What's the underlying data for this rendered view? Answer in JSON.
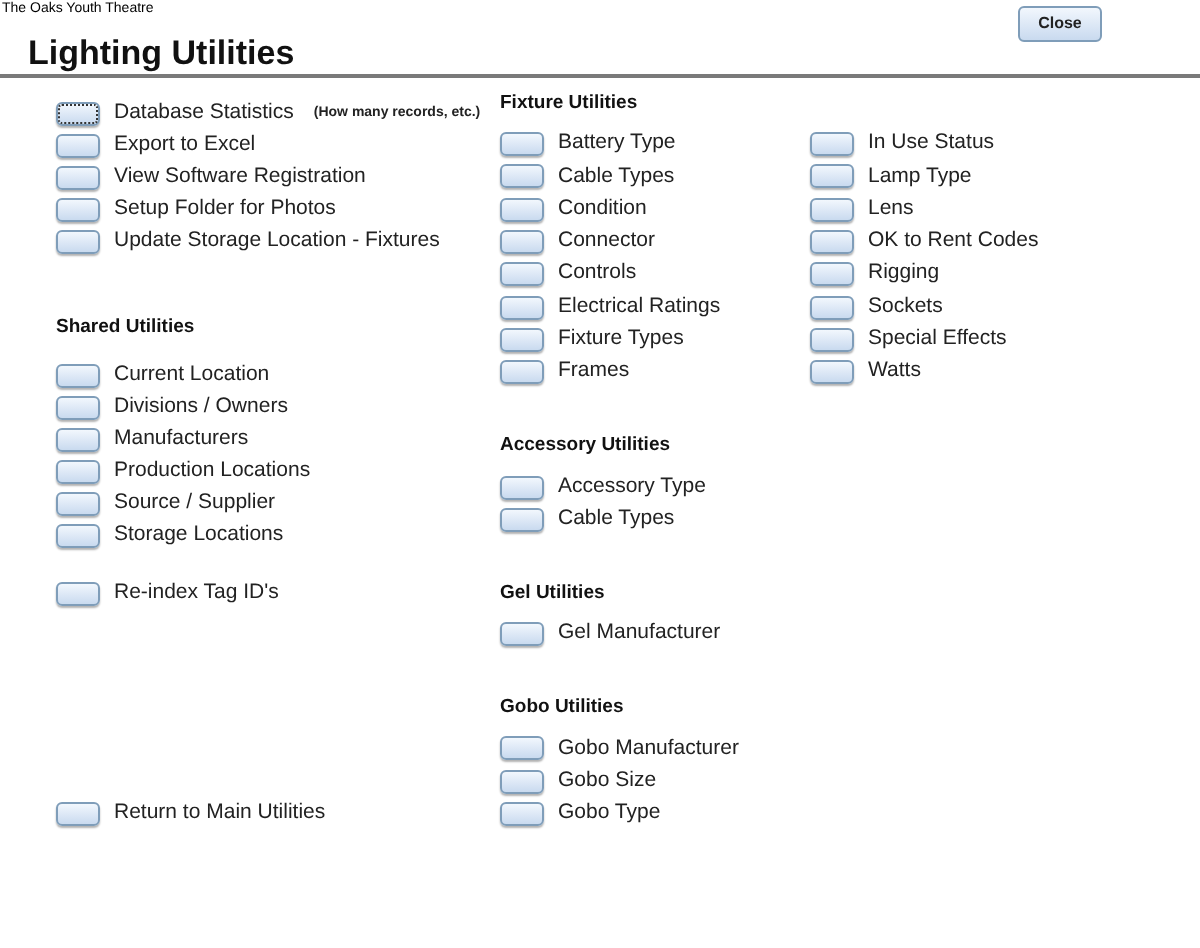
{
  "app_name": "The Oaks Youth Theatre",
  "title": "Lighting Utilities",
  "close_button": "Close",
  "general": {
    "items": [
      {
        "label": "Database Statistics",
        "note": "(How many records, etc.)",
        "focused": true
      },
      {
        "label": "Export to Excel",
        "focused": false
      },
      {
        "label": "View Software Registration",
        "focused": false
      },
      {
        "label": "Setup Folder for Photos",
        "focused": false
      },
      {
        "label": "Update Storage Location - Fixtures",
        "focused": false
      }
    ]
  },
  "shared_utilities": {
    "title": "Shared Utilities",
    "items": [
      "Current Location",
      "Divisions / Owners",
      "Manufacturers",
      "Production Locations",
      "Source / Supplier",
      "Storage Locations"
    ]
  },
  "reindex": "Re-index Tag ID's",
  "return": "Return to Main Utilities",
  "sections": [
    {
      "title": "Fixture Utilities",
      "columns": [
        [
          "Battery Type",
          "Cable Types",
          "Condition",
          "Connector",
          "Controls",
          "Electrical Ratings",
          "Fixture Types",
          "Frames"
        ],
        [
          "In Use Status",
          "Lamp Type",
          "Lens",
          "OK to Rent Codes",
          "Rigging",
          "Sockets",
          "Special Effects",
          "Watts"
        ]
      ]
    },
    {
      "title": "Accessory Utilities",
      "columns": [
        [
          "Accessory Type",
          "Cable Types"
        ]
      ]
    },
    {
      "title": "Gel Utilities",
      "columns": [
        [
          "Gel Manufacturer"
        ]
      ]
    },
    {
      "title": "Gobo Utilities",
      "columns": [
        [
          "Gobo Manufacturer",
          "Gobo Size",
          "Gobo Type"
        ]
      ]
    }
  ]
}
